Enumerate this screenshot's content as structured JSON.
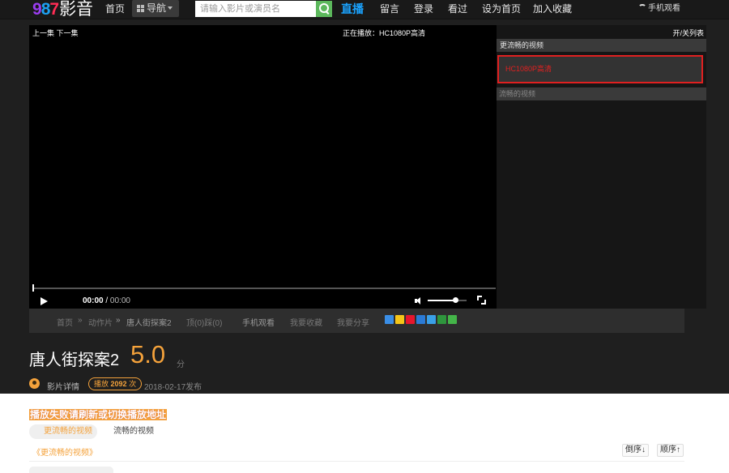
{
  "logo": {
    "d1": "9",
    "d2": "8",
    "d3": "7",
    "text": "影音"
  },
  "nav": {
    "home": "首页",
    "navigation": "导航",
    "search_placeholder": "请输入影片或演员名",
    "live": "直播",
    "message": "留言",
    "login": "登录",
    "history": "看过",
    "set_home": "设为首页",
    "add_favorite": "加入收藏",
    "mobile": "手机观看"
  },
  "player": {
    "prev_next": "上一集 下一集",
    "now_playing": "正在播放：HC1080P高清",
    "current_time": "00:00",
    "separator": " / ",
    "duration": "00:00",
    "progress": 0,
    "volume": 0.7
  },
  "panel": {
    "toggle_list": "开/关列表",
    "head": "更流畅的视频",
    "source": "HC1080P高清",
    "head2": "流畅的视频"
  },
  "breadcrumb": {
    "home": "首页",
    "sep1": "»",
    "category": "动作片",
    "sep2": "»",
    "title": "唐人街探案2",
    "votes": "顶(0)踩(0)",
    "mobile": "手机观看",
    "favorite": "我要收藏",
    "share": "我要分享"
  },
  "movie": {
    "title": "唐人街探案2",
    "score": "5.0",
    "score_unit": "分",
    "detail_link": "影片详情",
    "play_label": "播放",
    "play_count": "2092",
    "play_unit": "次",
    "release": "2018-02-17发布"
  },
  "sources": {
    "warning": "播放失败请刷新或切换播放地址",
    "tab_active": "更流畅的视频",
    "tab_inactive": "流畅的视频",
    "source_link": "《更流畅的视频》",
    "sort_desc": "倒序↓",
    "sort_asc": "顺序↑"
  },
  "colors": {
    "accent": "#f4a23b",
    "live": "#1aa3ff",
    "source_red": "#e02020"
  },
  "share_icons": [
    "plus-icon",
    "qzone-icon",
    "weibo-icon",
    "renren-icon",
    "qq-icon",
    "douban-icon",
    "wechat-icon"
  ]
}
